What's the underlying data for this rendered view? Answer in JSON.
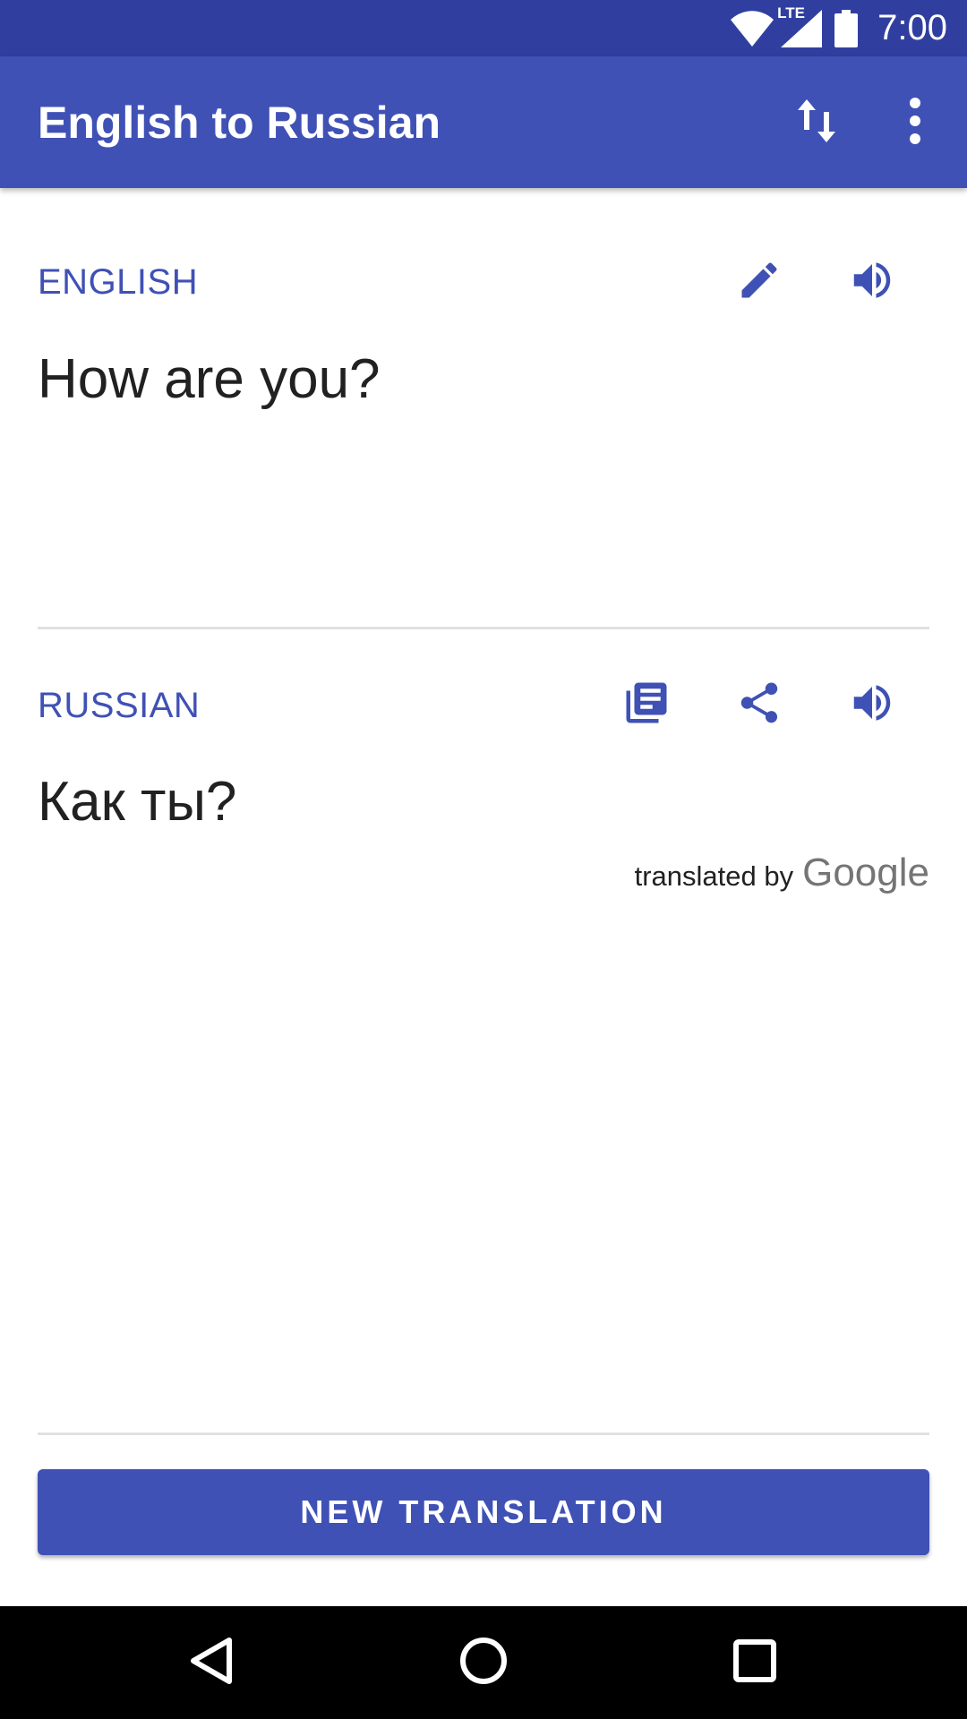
{
  "status_bar": {
    "time": "7:00",
    "network_label": "LTE",
    "icons": [
      "wifi-icon",
      "cell-signal-icon",
      "battery-icon"
    ]
  },
  "app_bar": {
    "title": "English to Russian",
    "actions": [
      "swap-languages-icon",
      "more-vert-icon"
    ],
    "color": "#3f51b5"
  },
  "source": {
    "language_label": "ENGLISH",
    "text": "How are you?",
    "actions": [
      "edit-icon",
      "speaker-icon"
    ]
  },
  "translation": {
    "language_label": "RUSSIAN",
    "text": "Как ты?",
    "actions": [
      "copy-icon",
      "share-icon",
      "speaker-icon"
    ]
  },
  "attribution": {
    "prefix": "translated by",
    "brand": "Google"
  },
  "primary_action": {
    "label": "NEW TRANSLATION"
  },
  "nav_bar": {
    "buttons": [
      "back-icon",
      "home-icon",
      "recents-icon"
    ]
  },
  "colors": {
    "accent": "#3f51b5",
    "status_bar": "#303f9f",
    "text_primary": "#212121"
  }
}
